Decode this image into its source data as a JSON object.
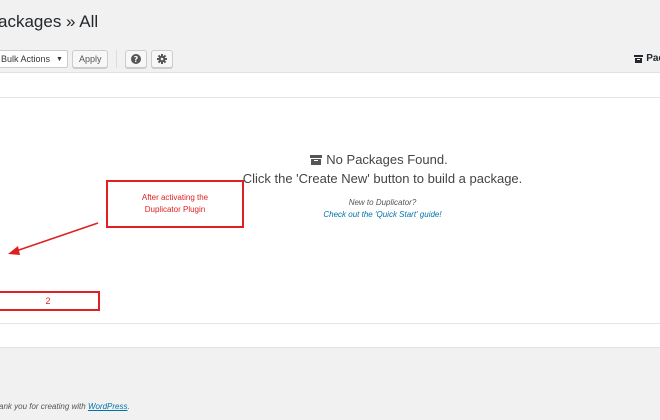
{
  "header": {
    "title": "ackages » All"
  },
  "toolbar": {
    "bulk_actions": "Bulk Actions",
    "apply_label": "Apply",
    "help_icon": "question-icon",
    "settings_icon": "gear-icon"
  },
  "top_right": {
    "label": "Pac",
    "icon": "archive-box-icon"
  },
  "empty_state": {
    "title": "No Packages Found.",
    "message": "Click the 'Create New' button to build a package.",
    "new_to": "New to Duplicator?",
    "quick_start_link": "Check out the 'Quick Start' guide!",
    "icon": "archive-box-icon"
  },
  "annotations": {
    "callout_line1": "After activating the",
    "callout_line2": "Duplicator Plugin",
    "number_box": "2",
    "color": "#e02020"
  },
  "footer": {
    "prefix": "ank you for creating with ",
    "link": "WordPress",
    "suffix": "."
  }
}
